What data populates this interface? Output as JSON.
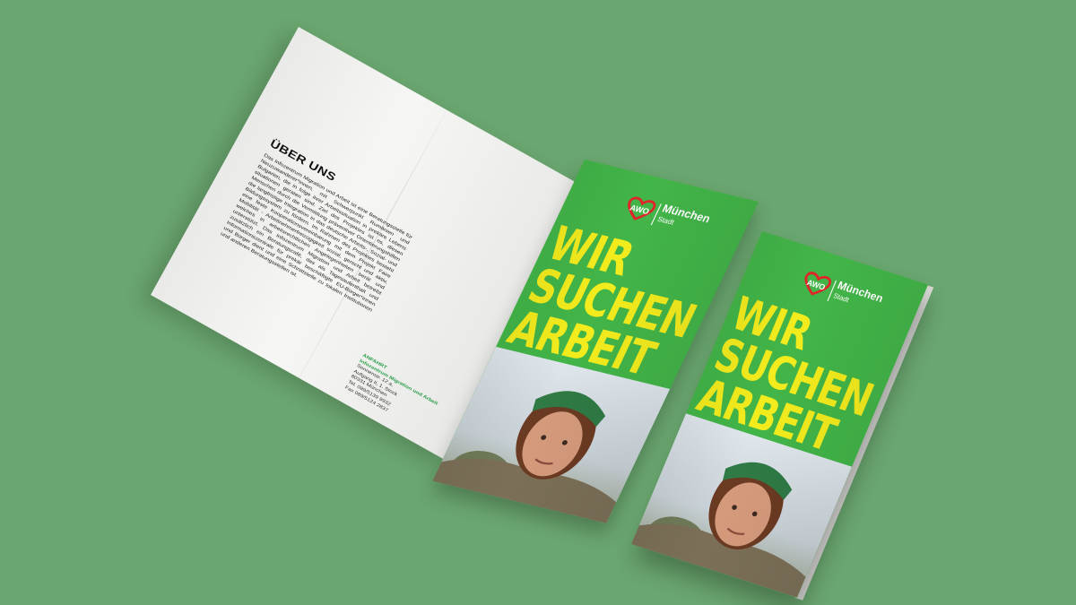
{
  "background_color": "#6aa66f",
  "brand_green": "#42b548",
  "headline_yellow": "#f3ec1d",
  "about": {
    "title": "ÜBER UNS",
    "body": "Das Infozentrum Migration und Arbeit ist eine Beratungsstelle für Neuzuwanderer*innen, mit Schwerpunkt Rumänien und Bulgarien, die in folge ihrer Arbeitssituation in prekäre Lebens situationen geraten sind. Ziel des Projektes ist es, diesen Menschen durch die Vermittlung präventiver Orientierungshilfen die langfristige Integration in das deutsche Arbeits-, Sozial- und Bildungssystem zu fördern. Im Rahmen des Projektes besteht eine feste Kooperationsvereinbarung mit dem Projekt Faire Mobilität - Arbeitnehmerfreizügigkeit sozial, gerecht und aktiv, welches in arbeitsrechtlichen Angelegenheiten berät und unterstützt. Das Infozentrum Migration und Arbeit betreibt zusätzlich ein Beratungscafé, das als Tagesaufenthalt und Informationszentrale für prekär beschäftigte EU-Bürger*innen und Bürger dient und eine Schnittstelle zu lokalen Institutionen und anderen Beratungsstellen ist."
  },
  "contact": {
    "heading": "ANFAHRT",
    "org": "Infozentrum Migration und Arbeit",
    "street": "Sonnenstr. 12 a,",
    "floor": "Aufgang II, 1. Stock",
    "city": "80331 München",
    "tel": "Tel. 089/5139 9932",
    "fax": "Fax 089/5124 2837"
  },
  "logo": {
    "mark": "AWO",
    "city": "München",
    "sub": "Stadt"
  },
  "headline": {
    "line1": "WIR",
    "line2": "SUCHEN",
    "line3": "ARBEIT"
  }
}
